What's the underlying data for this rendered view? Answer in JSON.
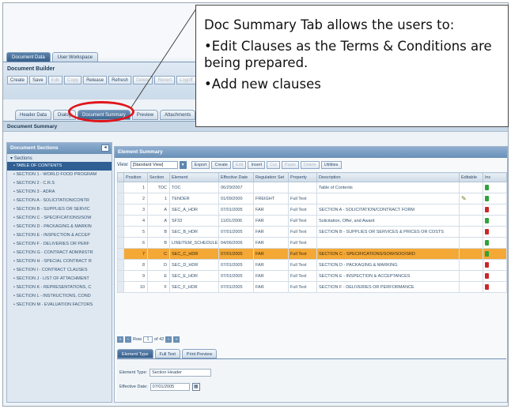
{
  "main_tabs": [
    {
      "label": "Document Data"
    },
    {
      "label": "User Workspace"
    }
  ],
  "builder": {
    "title": "Document Builder",
    "toolbar": [
      {
        "label": "Create",
        "enabled": true
      },
      {
        "label": "Save",
        "enabled": true
      },
      {
        "label": "Edit",
        "enabled": false
      },
      {
        "label": "Copy",
        "enabled": false
      },
      {
        "label": "Release",
        "enabled": true
      },
      {
        "label": "Refresh",
        "enabled": true
      },
      {
        "label": "Delete",
        "enabled": false
      },
      {
        "label": "Revert",
        "enabled": false
      },
      {
        "label": "Logoff",
        "enabled": false
      }
    ]
  },
  "sub_tabs": [
    {
      "label": "Header Data"
    },
    {
      "label": "Dialog"
    },
    {
      "label": "Document Summary"
    },
    {
      "label": "Preview"
    },
    {
      "label": "Attachments"
    }
  ],
  "summary_heading": "Document Summary",
  "sidebar": {
    "title": "Document Sections",
    "root": "Sections",
    "items": [
      {
        "label": "TABLE OF CONTENTS"
      },
      {
        "label": "SECTION 1 - WORLD FOOD PROGRAM"
      },
      {
        "label": "SECTION 2 - C.R.S"
      },
      {
        "label": "SECTION 3 - ADRA"
      },
      {
        "label": "SECTION A - SOLICITATION/CONTR"
      },
      {
        "label": "SECTION B - SUPPLIES OR SERVIC"
      },
      {
        "label": "SECTION C - SPECIFICATIONS/SOW"
      },
      {
        "label": "SECTION D - PACKAGING & MARKIN"
      },
      {
        "label": "SECTION E - INSPECTION & ACCEP"
      },
      {
        "label": "SECTION F - DELIVERIES OR PERF"
      },
      {
        "label": "SECTION G - CONTRACT ADMINISTR"
      },
      {
        "label": "SECTION H - SPECIAL CONTRACT R"
      },
      {
        "label": "SECTION I - CONTRACT CLAUSES"
      },
      {
        "label": "SECTION J - LIST OF ATTACHMENT"
      },
      {
        "label": "SECTION K - REPRESENTATIONS, C"
      },
      {
        "label": "SECTION L - INSTRUCTIONS, COND"
      },
      {
        "label": "SECTION M - EVALUATION FACTORS"
      }
    ]
  },
  "element_summary": {
    "title": "Element Summary",
    "view_label": "View:",
    "view_value": "[Standard View]",
    "buttons": [
      {
        "label": "Export",
        "enabled": true
      },
      {
        "label": "Create",
        "enabled": true
      },
      {
        "label": "Edit",
        "enabled": false
      },
      {
        "label": "Insert",
        "enabled": true
      },
      {
        "label": "Cut",
        "enabled": false
      },
      {
        "label": "Paste",
        "enabled": false
      },
      {
        "label": "Delete",
        "enabled": false
      },
      {
        "label": "Utilities",
        "enabled": true
      }
    ],
    "columns": [
      "Position",
      "Section",
      "Element",
      "Effective Date",
      "Regulation Set",
      "Property",
      "Description",
      "Editable",
      "Inc"
    ],
    "rows": [
      {
        "position": "1",
        "section": "TOC",
        "element": "TOC",
        "date": "06/29/2007",
        "reg": "",
        "property": "",
        "description": "Table of Contents",
        "editable": "",
        "status": "green"
      },
      {
        "position": "2",
        "section": "1",
        "element": "TENDER",
        "date": "01/09/2000",
        "reg": "FREIGHT",
        "property": "Full Text",
        "description": "",
        "editable": "pencil",
        "status": "green"
      },
      {
        "position": "3",
        "section": "A",
        "element": "SEC_A_HDR",
        "date": "07/01/2005",
        "reg": "FAR",
        "property": "Full Text",
        "description": "SECTION A - SOLICITATION/CONTRACT FORM",
        "editable": "",
        "status": "red"
      },
      {
        "position": "4",
        "section": "A",
        "element": "SF33",
        "date": "11/01/2006",
        "reg": "FAR",
        "property": "Full Text",
        "description": "Solicitation, Offer, and Award",
        "editable": "",
        "status": "green"
      },
      {
        "position": "5",
        "section": "B",
        "element": "SEC_B_HDR",
        "date": "07/01/2005",
        "reg": "FAR",
        "property": "Full Text",
        "description": "SECTION B - SUPPLIES OR SERVICES & PRICES OR COSTS",
        "editable": "",
        "status": "red"
      },
      {
        "position": "6",
        "section": "B",
        "element": "LINEITEM_SCHEDULE",
        "date": "04/06/2006",
        "reg": "FAR",
        "property": "Full Text",
        "description": "",
        "editable": "",
        "status": "green"
      },
      {
        "position": "7",
        "section": "C",
        "element": "SEC_C_HDR",
        "date": "07/01/2005",
        "reg": "FAR",
        "property": "Full Text",
        "description": "SECTION C - SPECIFICATIONS/SOW/SOO/SRD",
        "editable": "",
        "status": "green",
        "selected": true
      },
      {
        "position": "8",
        "section": "D",
        "element": "SEC_D_HDR",
        "date": "07/01/2005",
        "reg": "FAR",
        "property": "Full Text",
        "description": "SECTION D - PACKAGING & MARKING",
        "editable": "",
        "status": "red"
      },
      {
        "position": "9",
        "section": "E",
        "element": "SEC_E_HDR",
        "date": "07/01/2005",
        "reg": "FAR",
        "property": "Full Text",
        "description": "SECTION E - INSPECTION & ACCEPTANCES",
        "editable": "",
        "status": "red"
      },
      {
        "position": "10",
        "section": "F",
        "element": "SEC_F_HDR",
        "date": "07/01/2005",
        "reg": "FAR",
        "property": "Full Text",
        "description": "SECTION F - DELIVERIES OR PERFORMANCE",
        "editable": "",
        "status": "red"
      }
    ],
    "pager": {
      "row_label": "Row",
      "row_value": "1",
      "of_label": "of 42"
    },
    "lower_tabs": [
      {
        "label": "Element Type"
      },
      {
        "label": "Full Text"
      },
      {
        "label": "Print Preview"
      }
    ],
    "element_type_label": "Element Type:",
    "element_type_value": "Section Header",
    "effective_date_label": "Effective Date:",
    "effective_date_value": "07/01/2005"
  },
  "callout": {
    "heading": "Doc Summary Tab allows the users to:",
    "bullet1": "•Edit Clauses as the Terms & Conditions are being prepared.",
    "bullet2": "•Add new clauses"
  },
  "colors": {
    "selected_row": "#f4a835",
    "highlight_oval": "#e0161b",
    "status_green": "#2fa23a",
    "status_red": "#c8282b"
  }
}
